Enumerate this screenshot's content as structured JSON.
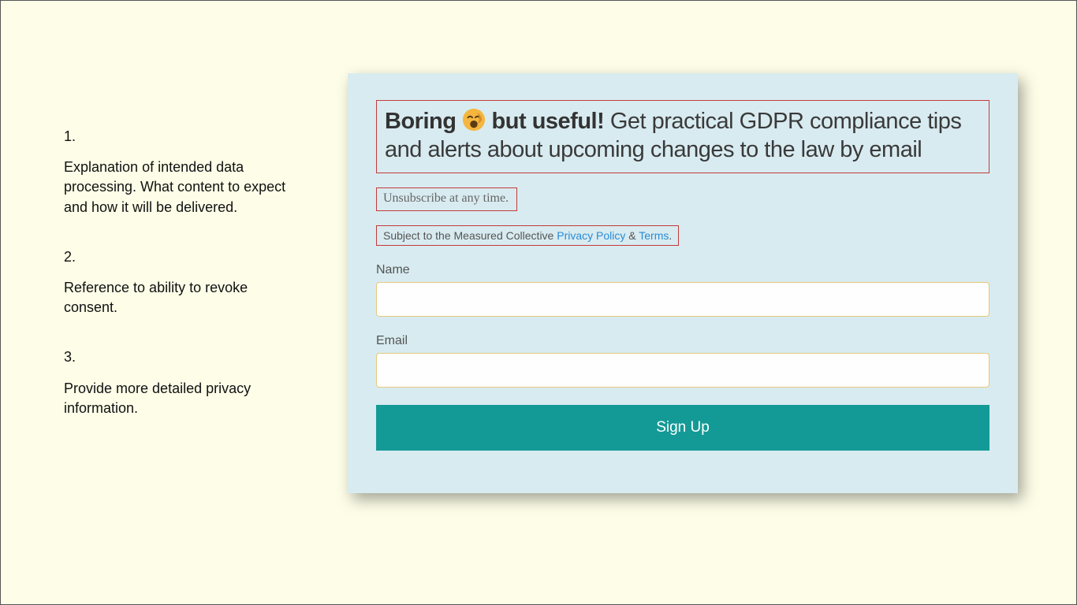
{
  "annotations": [
    {
      "num": "1.",
      "text": "Explanation of intended data processing. What content to expect and how it will be delivered."
    },
    {
      "num": "2.",
      "text": "Reference to ability to revoke consent."
    },
    {
      "num": "3.",
      "text": "Provide more detailed privacy information."
    }
  ],
  "form": {
    "headline_bold_pre": "Boring ",
    "headline_bold_post": " but useful!",
    "headline_rest": " Get practical GDPR compliance tips and alerts about upcoming changes to the law by email",
    "unsubscribe": "Unsubscribe at any time.",
    "legal_prefix": "Subject to the Measured Collective ",
    "privacy_link": "Privacy Policy",
    "legal_amp": " & ",
    "terms_link": "Terms",
    "legal_suffix": ".",
    "name_label": "Name",
    "email_label": "Email",
    "submit": "Sign Up"
  }
}
